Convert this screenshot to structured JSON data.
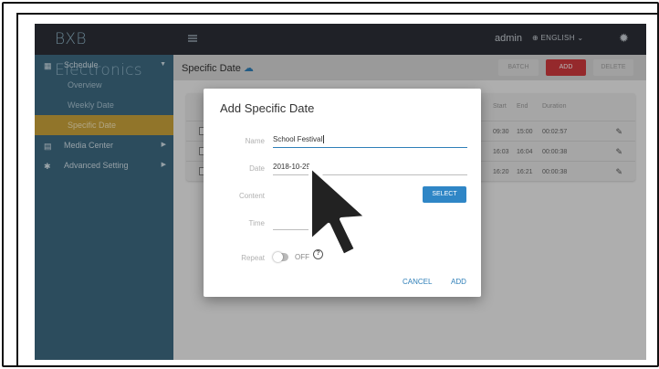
{
  "app": {
    "brand": "BXB Electronics"
  },
  "sidebar": {
    "items": [
      {
        "label": "Schedule",
        "icon": "calendar-icon"
      },
      {
        "label": "Overview"
      },
      {
        "label": "Weekly Date"
      },
      {
        "label": "Specific Date"
      },
      {
        "label": "Media Center",
        "icon": "media-icon"
      },
      {
        "label": "Advanced Setting",
        "icon": "gear-icon"
      }
    ]
  },
  "topbar": {
    "user": "admin",
    "language": "ENGLISH"
  },
  "page": {
    "title": "Specific Date",
    "buttons": {
      "batch": "BATCH",
      "add": "ADD",
      "delete": "DELETE"
    }
  },
  "table": {
    "headers": {
      "start": "Start",
      "end": "End",
      "duration": "Duration"
    },
    "rows": [
      {
        "start": "09:30",
        "end": "15:00",
        "duration": "00:02:57"
      },
      {
        "start": "16:03",
        "end": "16:04",
        "duration": "00:00:38"
      },
      {
        "start": "16:20",
        "end": "16:21",
        "duration": "00:00:38"
      }
    ]
  },
  "dialog": {
    "title": "Add Specific Date",
    "name_label": "Name",
    "name_value": "School Festival",
    "date_label": "Date",
    "date_value": "2018-10-29",
    "content_label": "Content",
    "select_label": "SELECT",
    "time_label": "Time",
    "repeat_label": "Repeat",
    "repeat_state": "OFF",
    "cancel_label": "CANCEL",
    "add_label": "ADD"
  },
  "colors": {
    "accent": "#2f86c6",
    "add_button": "#cf3a3d",
    "sidebar": "#3e6a82",
    "active_item": "#c9a23b"
  }
}
